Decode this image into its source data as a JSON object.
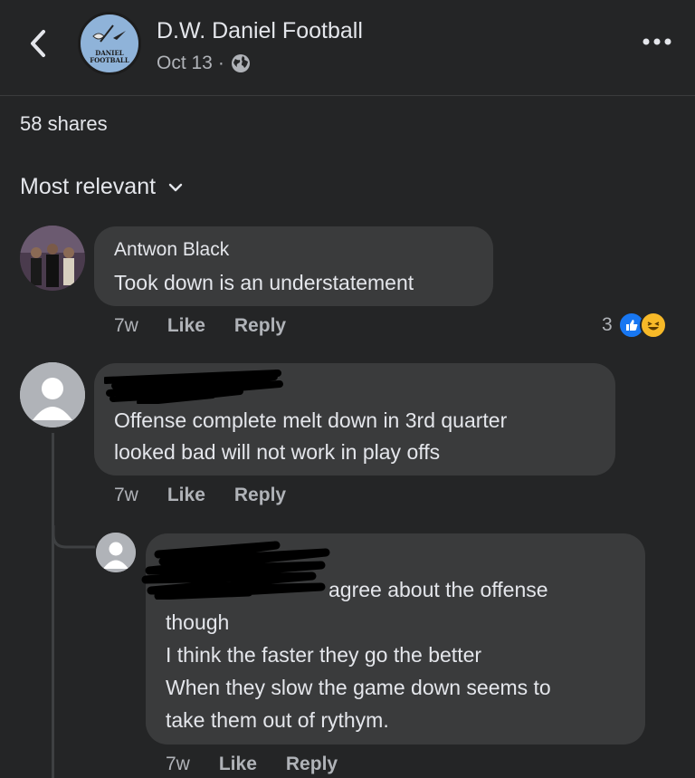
{
  "header": {
    "page_name": "D.W. Daniel Football",
    "date": "Oct 13",
    "separator": "·",
    "logo_text_line1": "DANIEL",
    "logo_text_line2": "FOOTBALL"
  },
  "shares": "58 shares",
  "sort": {
    "label": "Most relevant"
  },
  "comments": [
    {
      "author": "Antwon Black",
      "text_lines": [
        "Took down is an understatement"
      ],
      "time": "7w",
      "like": "Like",
      "reply": "Reply",
      "reaction_count": "3",
      "reactions": [
        "like",
        "haha"
      ]
    },
    {
      "author": "",
      "text_lines": [
        "Offense  complete melt down in 3rd quarter",
        "looked bad will not work in play offs"
      ],
      "time": "7w",
      "like": "Like",
      "reply": "Reply"
    },
    {
      "author": "",
      "text_lines": [
        "agree about the offense",
        "though",
        "I think the faster they go the better",
        "When they slow the game down seems to",
        "take them out of rythym."
      ],
      "time": "7w",
      "like": "Like",
      "reply": "Reply"
    }
  ],
  "colors": {
    "background": "#242526",
    "bubble": "#3a3b3c",
    "like_blue": "#1877f2",
    "haha_yellow": "#f7b928"
  }
}
